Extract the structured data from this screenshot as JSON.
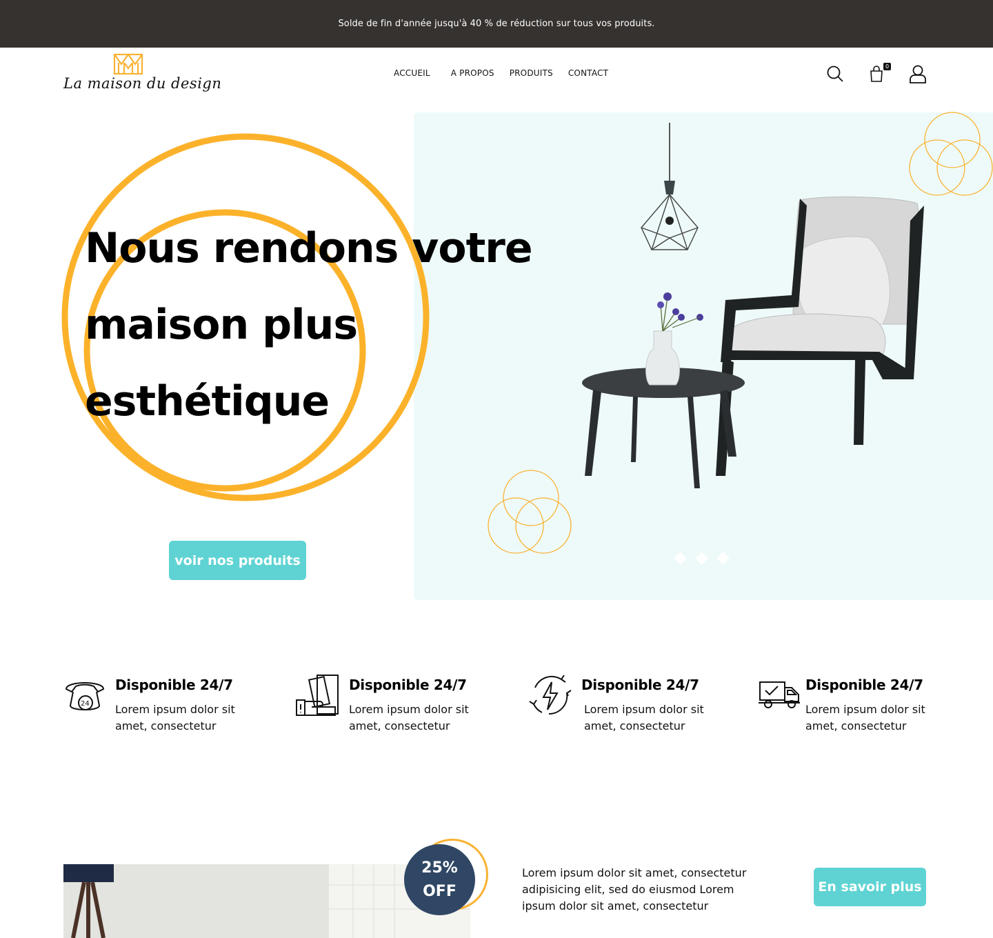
{
  "announcement": "Solde de fin d'année jusqu'à 40 % de réduction sur tous vos produits.",
  "brand": {
    "name": "La maison du design",
    "logo_icon": "m-monogram-logo",
    "accent": "#f9b233"
  },
  "nav": [
    {
      "label": "ACCUEIL"
    },
    {
      "label": "A PROPOS"
    },
    {
      "label": "PRODUITS"
    },
    {
      "label": "CONTACT"
    }
  ],
  "header_icons": {
    "search": "search-icon",
    "cart": "cart-icon",
    "cart_count": "0",
    "account": "user-icon"
  },
  "hero": {
    "title": "Nous rendons votre maison plus esthétique",
    "cta_label": "voir nos produits",
    "panel_color": "#eefaf9",
    "cta_color": "#5fd3d3",
    "slides_total": 3
  },
  "features": [
    {
      "icon": "phone-24-icon",
      "title": "Disponible 24/7",
      "text": "Lorem ipsum dolor sit amet, consectetur"
    },
    {
      "icon": "money-hand-icon",
      "title": "Disponible 24/7",
      "text": "Lorem ipsum dolor sit amet, consectetur"
    },
    {
      "icon": "lightning-refresh-icon",
      "title": "Disponible 24/7",
      "text": "Lorem ipsum dolor sit amet, consectetur"
    },
    {
      "icon": "delivery-truck-icon",
      "title": "Disponible 24/7",
      "text": "Lorem ipsum dolor sit amet, consectetur"
    }
  ],
  "promo": {
    "badge_line1": "25%",
    "badge_line2": "OFF",
    "text": "Lorem ipsum dolor sit amet, consectetur adipisicing elit, sed do eiusmod Lorem ipsum dolor sit amet, consectetur",
    "button_label": "En savoir plus",
    "badge_color": "#2f4764"
  }
}
